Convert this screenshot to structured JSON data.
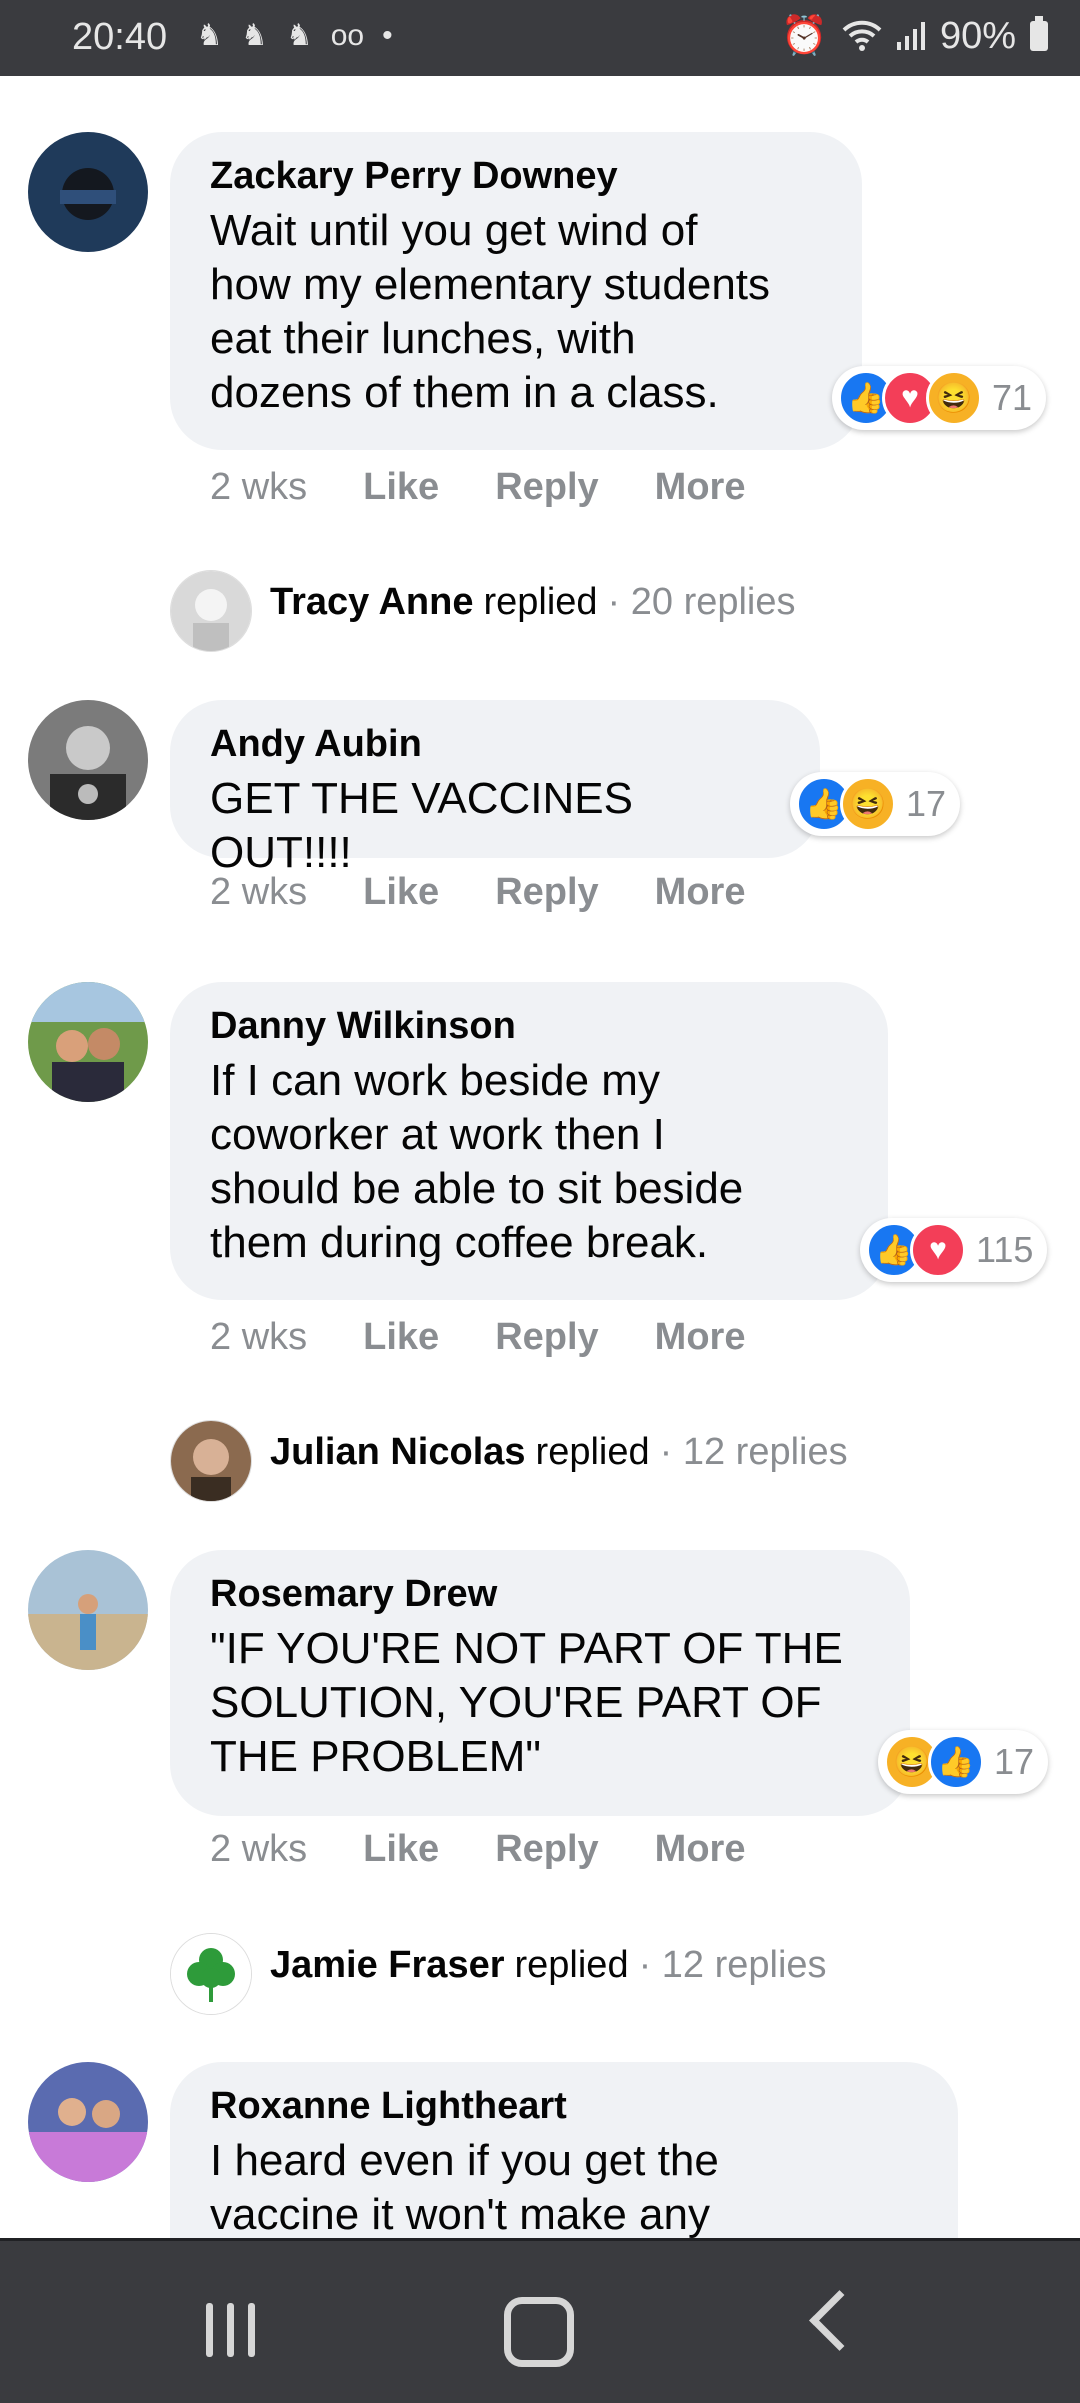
{
  "status_bar": {
    "time": "20:40",
    "battery": "90%",
    "icons": [
      "elephant-icon",
      "elephant-icon",
      "elephant-icon",
      "voicemail-icon",
      "dot-icon",
      "alarm-icon",
      "wifi-icon",
      "signal-icon",
      "battery-icon"
    ]
  },
  "comments": [
    {
      "name": "Zackary Perry Downey",
      "text": [
        "Wait until you get wind of",
        "how my elementary students",
        "eat their lunches, with",
        "dozens of them in a class."
      ],
      "reactions": [
        "like",
        "love",
        "haha"
      ],
      "reaction_count": "71",
      "time": "2 wks",
      "actions": [
        "Like",
        "Reply",
        "More"
      ],
      "avatar_color": "#1f3a5a"
    },
    {
      "name": "Andy Aubin",
      "text": [
        "GET THE VACCINES OUT!!!!"
      ],
      "reactions": [
        "like",
        "haha"
      ],
      "reaction_count": "17",
      "time": "2 wks",
      "actions": [
        "Like",
        "Reply",
        "More"
      ],
      "avatar_color": "#6b6b6b"
    },
    {
      "name": "Danny Wilkinson",
      "text": [
        "If I can work beside my",
        "coworker at work then I",
        "should be able to sit beside",
        "them during coffee break."
      ],
      "reactions": [
        "like",
        "love"
      ],
      "reaction_count": "115",
      "time": "2 wks",
      "actions": [
        "Like",
        "Reply",
        "More"
      ],
      "avatar_color": "#5b7a3a"
    },
    {
      "name": "Rosemary Drew",
      "text": [
        "\"IF YOU'RE NOT PART OF THE",
        "SOLUTION, YOU'RE PART OF",
        "THE PROBLEM\""
      ],
      "reactions": [
        "haha",
        "like"
      ],
      "reaction_count": "17",
      "time": "2 wks",
      "actions": [
        "Like",
        "Reply",
        "More"
      ],
      "avatar_color": "#8aa3b8"
    },
    {
      "name": "Roxanne Lightheart",
      "text": [
        "I heard even if you get the",
        "vaccine it won't make any"
      ],
      "avatar_color": "#7a5aa8"
    }
  ],
  "replies": [
    {
      "name": "Tracy Anne",
      "word": "replied",
      "count": "· 20 replies"
    },
    {
      "name": "Julian Nicolas",
      "word": "replied",
      "count": "· 12 replies"
    },
    {
      "name": "Jamie Fraser",
      "word": "replied",
      "count": "· 12 replies"
    }
  ]
}
